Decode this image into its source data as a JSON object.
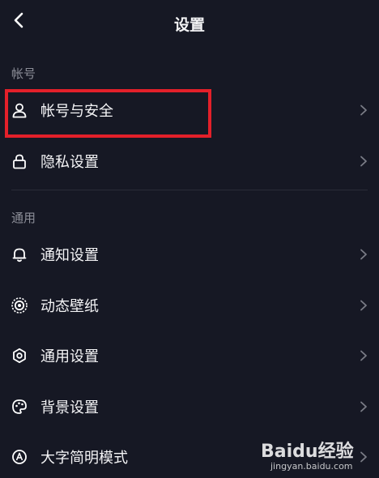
{
  "header": {
    "title": "设置"
  },
  "sections": {
    "account": "帐号",
    "general": "通用"
  },
  "rows": {
    "account_security": "帐号与安全",
    "privacy": "隐私设置",
    "notifications": "通知设置",
    "wallpaper": "动态壁纸",
    "general_settings": "通用设置",
    "background": "背景设置",
    "large_text": "大字简明模式"
  },
  "colors": {
    "background": "#161824",
    "highlight": "#e3202a",
    "section_label": "#8c8e98"
  },
  "watermark": {
    "brand": "Baidu经验",
    "url": "jingyan.baidu.com"
  }
}
